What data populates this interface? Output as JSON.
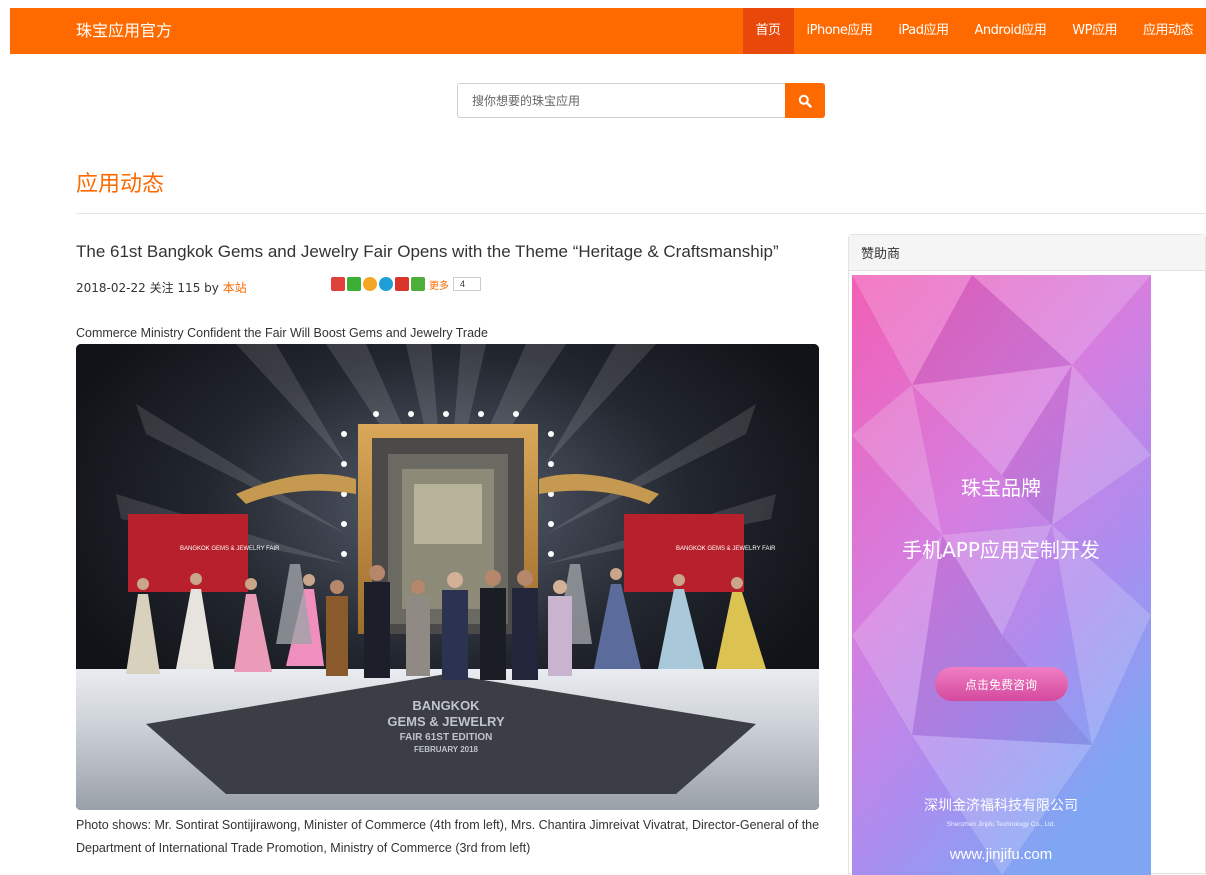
{
  "header": {
    "brand": "珠宝应用官方",
    "nav": [
      "首页",
      "iPhone应用",
      "iPad应用",
      "Android应用",
      "WP应用",
      "应用动态"
    ]
  },
  "search": {
    "placeholder": "搜你想要的珠宝应用"
  },
  "section": {
    "title": "应用动态"
  },
  "article": {
    "title": "The 61st Bangkok Gems and Jewelry Fair Opens with the Theme “Heritage & Craftsmanship”",
    "date": "2018-02-22",
    "follow_label": "关注",
    "follow_count": "115",
    "by_label": "by",
    "author": "本站",
    "share_more": "更多",
    "share_count": "4",
    "subhead": "Commerce Ministry Confident the Fair Will Boost Gems and Jewelry Trade",
    "caption": "Photo shows: Mr. Sontirat Sontijirawong, Minister of Commerce (4th from left), Mrs. Chantira Jimreivat Vivatrat, Director-General of the Department of International Trade Promotion, Ministry of Commerce (3rd from left)"
  },
  "photo": {
    "banner_text": "BANGKOK GEMS & JEWELRY FAIR",
    "floor_text_1": "BANGKOK",
    "floor_text_2": "GEMS & JEWELRY",
    "floor_text_3": "FAIR 61ST EDITION",
    "floor_text_4": "FEBRUARY 2018"
  },
  "sidebar": {
    "title": "赞助商",
    "ad": {
      "line1": "珠宝品牌",
      "line2": "手机APP应用定制开发",
      "button": "点击免费咨询",
      "company": "深圳金济福科技有限公司",
      "company_en": "Shenzhen Jinjifu Technology Co., Ltd.",
      "url": "www.jinjifu.com"
    }
  },
  "colors": {
    "accent": "#ff6a00",
    "nav_active": "#e8480a"
  }
}
